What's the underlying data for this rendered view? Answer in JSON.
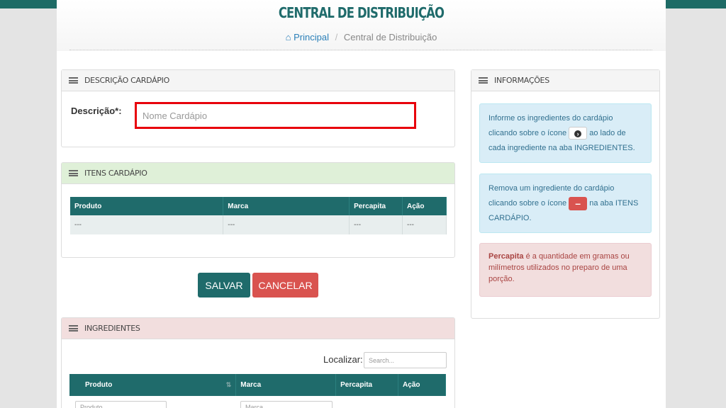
{
  "header": {
    "title": "CENTRAL DE DISTRIBUIÇÃO",
    "breadcrumb_home_icon": "home-icon",
    "breadcrumb_home": "Principal",
    "breadcrumb_sep": "/",
    "breadcrumb_current": "Central de Distribuição"
  },
  "descricao_panel": {
    "title": "DESCRIÇÃO CARDÁPIO",
    "label": "Descrição*:",
    "placeholder": "Nome Cardápio",
    "value": ""
  },
  "itens_panel": {
    "title": "ITENS CARDÁPIO",
    "columns": [
      "Produto",
      "Marca",
      "Percapita",
      "Ação"
    ],
    "rows": [
      [
        "---",
        "---",
        "---",
        "---"
      ]
    ]
  },
  "actions": {
    "save": "SALVAR",
    "cancel": "CANCELAR"
  },
  "ingredientes_panel": {
    "title": "INGREDIENTES",
    "search_label": "Localizar:",
    "search_placeholder": "Search...",
    "columns": [
      "Produto",
      "Marca",
      "Percapita",
      "Ação"
    ],
    "filter_placeholders": [
      "Produto",
      "Marca"
    ]
  },
  "info_panel": {
    "title": "INFORMAÇÕES",
    "info1_a": "Informe os ingredientes do cardápio clicando sobre o ícone",
    "info1_b": "ao lado de cada ingrediente na aba INGREDIENTES.",
    "info2_a": "Remova um ingrediente do cardápio clicando sobre o ícone",
    "info2_b": "na aba ITENS CARDÁPIO.",
    "danger_bold": "Percapita",
    "danger_rest": "é a quantidade em gramas ou milímetros utilizados no preparo de uma porção."
  },
  "colors": {
    "primary": "#1f6b6b",
    "danger": "#d9534f",
    "highlight_border": "#e8000b"
  }
}
